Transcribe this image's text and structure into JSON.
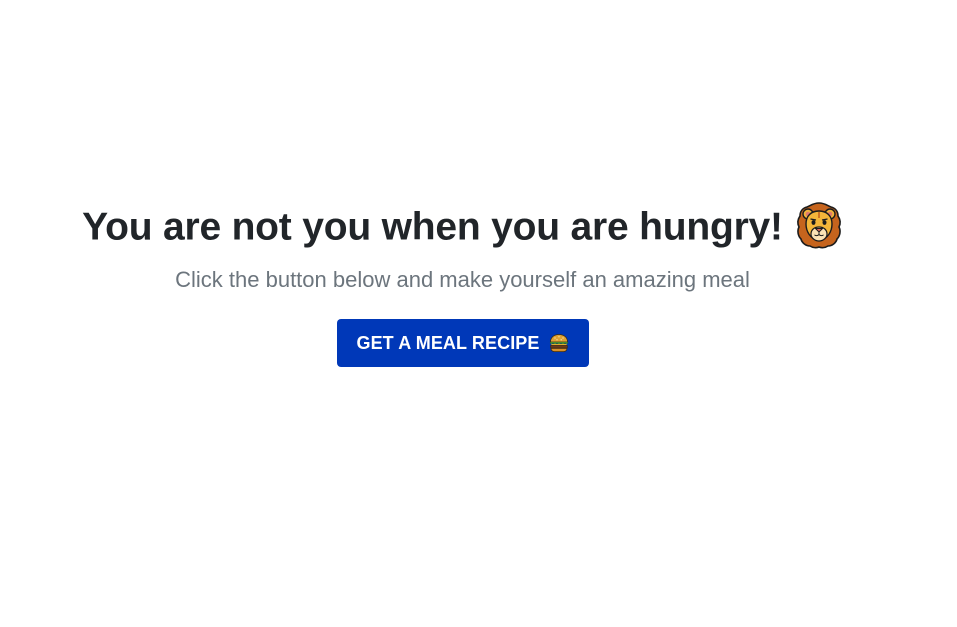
{
  "hero": {
    "headline": "You are not you when you are hungry!",
    "headline_icon": "lion-face-emoji",
    "subtitle": "Click the button below and make yourself an amazing meal",
    "cta_label": "GET A MEAL RECIPE",
    "cta_icon": "hamburger-emoji"
  },
  "colors": {
    "headline": "#212529",
    "subtitle": "#6c757d",
    "button_bg": "#0038b8",
    "button_text": "#ffffff",
    "background": "#ffffff"
  }
}
